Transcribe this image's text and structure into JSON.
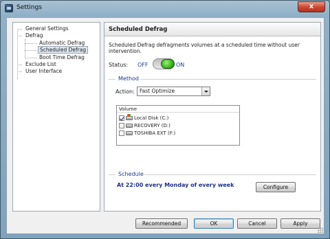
{
  "window": {
    "title": "Settings",
    "close_label": "x"
  },
  "tree": {
    "items": [
      {
        "label": "General Settings"
      },
      {
        "label": "Defrag"
      },
      {
        "label": "Automatic Defrag"
      },
      {
        "label": "Scheduled Defrag"
      },
      {
        "label": "Boot Time Defrag"
      },
      {
        "label": "Exclude List"
      },
      {
        "label": "User Interface"
      }
    ],
    "selected": "Scheduled Defrag"
  },
  "panel": {
    "header": "Scheduled Defrag",
    "description": "Scheduled Defrag defragments volumes at a scheduled time without user intervention.",
    "status_label": "Status:",
    "status_off": "OFF",
    "status_on": "ON",
    "status_enabled": true
  },
  "method": {
    "section_title": "Method",
    "action_label": "Action:",
    "action_value": "Fast Optimize",
    "volume_header": "Volume",
    "volumes": [
      {
        "label": "Local Disk (C:)",
        "checked": true,
        "icon": "system-drive-icon"
      },
      {
        "label": "RECOVERY (D:)",
        "checked": false,
        "icon": "drive-icon"
      },
      {
        "label": "TOSHIBA EXT (F:)",
        "checked": false,
        "icon": "drive-icon"
      }
    ]
  },
  "schedule": {
    "section_title": "Schedule",
    "summary": "At 22:00 every Monday of every week",
    "configure_label": "Configure"
  },
  "footer": {
    "recommended_label": "Recommended",
    "ok_label": "OK",
    "cancel_label": "Cancel",
    "apply_label": "Apply"
  },
  "colors": {
    "accent_blue": "#15378f",
    "toggle_green": "#3dbb24",
    "close_red": "#cc4b35"
  }
}
